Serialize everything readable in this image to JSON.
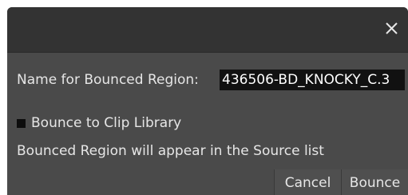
{
  "dialog": {
    "close_icon": "close-icon",
    "name_label": "Name for Bounced Region:",
    "name_value": "436506-BD_KNOCKY_C.3",
    "checkbox_label": "Bounce to Clip Library",
    "checkbox_checked": false,
    "info_text": "Bounced Region will appear in the Source list",
    "cancel_label": "Cancel",
    "bounce_label": "Bounce"
  },
  "colors": {
    "dialog_bg": "#4a4a4a",
    "titlebar_bg": "#333333",
    "input_bg": "#111111",
    "text": "#e6e6e6"
  }
}
